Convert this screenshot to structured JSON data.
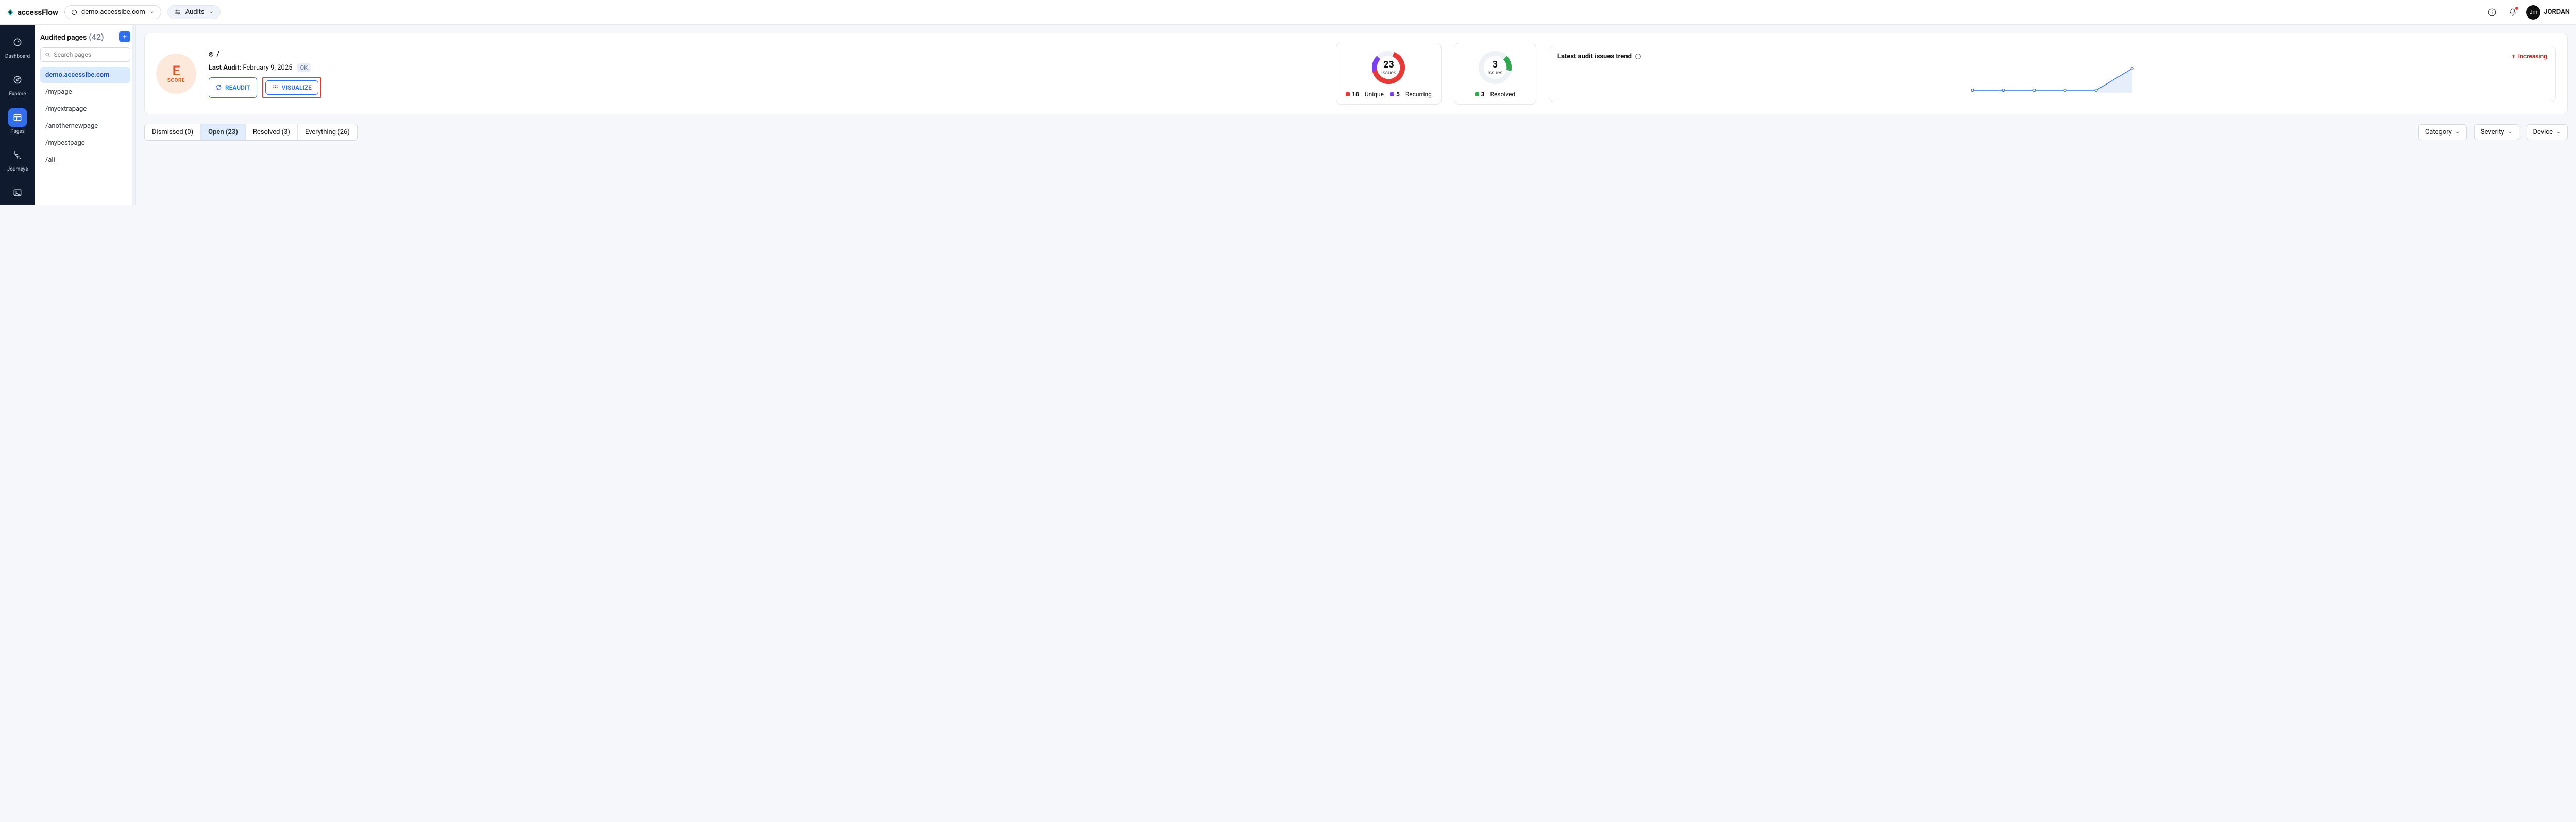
{
  "header": {
    "brand": "accessFlow",
    "domain": "demo.accessibe.com",
    "audits_label": "Audits",
    "user_initials": "Jm",
    "user_name": "JORDAN"
  },
  "leftnav": {
    "items": [
      {
        "label": "Dashboard",
        "icon": "dashboard-icon"
      },
      {
        "label": "Explore",
        "icon": "compass-icon"
      },
      {
        "label": "Pages",
        "icon": "pages-icon",
        "active": true
      },
      {
        "label": "Journeys",
        "icon": "journeys-icon"
      }
    ]
  },
  "sidepanel": {
    "title": "Audited pages",
    "count": "(42)",
    "search_placeholder": "Search pages",
    "items": [
      {
        "label": "demo.accessibe.com",
        "active": true
      },
      {
        "label": "/mypage"
      },
      {
        "label": "/myextrapage"
      },
      {
        "label": "/anothernewpage"
      },
      {
        "label": "/mybestpage"
      },
      {
        "label": "/all"
      }
    ]
  },
  "hero": {
    "score_letter": "E",
    "score_word": "SCORE",
    "crumb_main": "/",
    "last_audit_label": "Last Audit:",
    "last_audit_value": "February 9, 2025",
    "ok_badge": "OK",
    "reaudit_btn": "REAUDIT",
    "visualize_btn": "VISUALIZE"
  },
  "issues_card": {
    "value": "23",
    "label": "Issues",
    "legend": [
      {
        "color": "#e53935",
        "count": "18",
        "text": "Unique"
      },
      {
        "color": "#7b3ff2",
        "count": "5",
        "text": "Recurring"
      }
    ]
  },
  "resolved_card": {
    "value": "3",
    "label": "Issues",
    "legend": [
      {
        "color": "#2fa84f",
        "count": "3",
        "text": "Resolved"
      }
    ]
  },
  "trend": {
    "title": "Latest audit issues trend",
    "status": "Increasing"
  },
  "tabs": [
    {
      "label": "Dismissed (0)"
    },
    {
      "label": "Open (23)",
      "active": true
    },
    {
      "label": "Resolved (3)"
    },
    {
      "label": "Everything (26)"
    }
  ],
  "filters": {
    "category": "Category",
    "severity": "Severity",
    "device": "Device"
  },
  "chart_data": [
    {
      "type": "pie",
      "title": "Issues breakdown",
      "series": [
        {
          "name": "Unique",
          "values": [
            18
          ],
          "color": "#e53935"
        },
        {
          "name": "Recurring",
          "values": [
            5
          ],
          "color": "#7b3ff2"
        }
      ],
      "total_label": "23 Issues"
    },
    {
      "type": "pie",
      "title": "Resolved",
      "series": [
        {
          "name": "Resolved",
          "values": [
            3
          ],
          "color": "#2fa84f"
        }
      ],
      "total_label": "3 Issues"
    },
    {
      "type": "line",
      "title": "Latest audit issues trend",
      "x": [
        1,
        2,
        3,
        4,
        5,
        6
      ],
      "values": [
        5,
        5,
        5,
        5,
        5,
        23
      ],
      "ylim": [
        0,
        25
      ],
      "annotation": "Increasing"
    }
  ]
}
